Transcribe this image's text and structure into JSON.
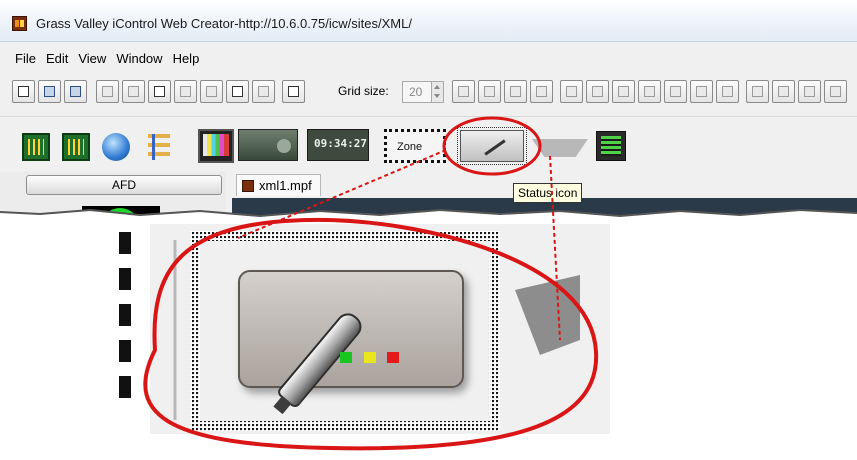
{
  "window": {
    "title": "Grass Valley iControl Web Creator-http://10.6.0.75/icw/sites/XML/"
  },
  "menu": {
    "items": [
      "File",
      "Edit",
      "View",
      "Window",
      "Help"
    ]
  },
  "toolbar": {
    "grid_label": "Grid size:",
    "grid_value": "20"
  },
  "components": {
    "clock_text": "09:34:27",
    "zone_label": "Zone"
  },
  "tooltip": {
    "text": "Status icon"
  },
  "left_panel": {
    "afd_button": "AFD"
  },
  "document": {
    "tab_label": "xml1.mpf"
  },
  "callout": {
    "color": "#d91515",
    "zoom_target": "status-icon-button"
  },
  "status_leds": {
    "colors": [
      "#19c520",
      "#e9e61e",
      "#e51a1a"
    ]
  }
}
